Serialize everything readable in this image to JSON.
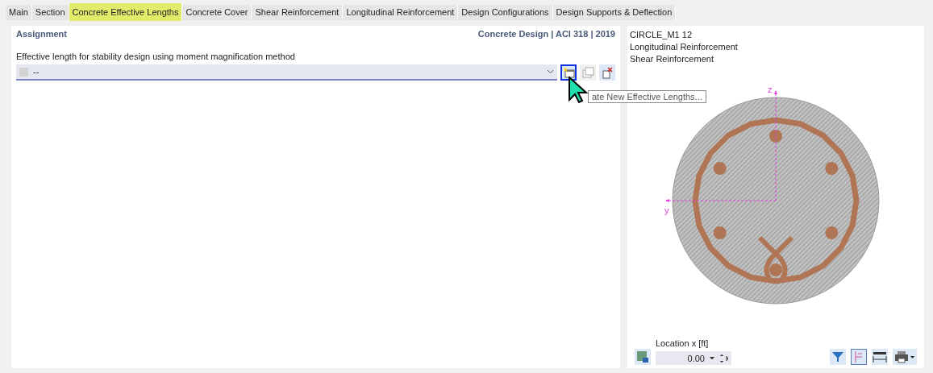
{
  "tabs": [
    {
      "label": "Main",
      "selected": false
    },
    {
      "label": "Section",
      "selected": false
    },
    {
      "label": "Concrete Effective Lengths",
      "selected": true
    },
    {
      "label": "Concrete Cover",
      "selected": false
    },
    {
      "label": "Shear Reinforcement",
      "selected": false
    },
    {
      "label": "Longitudinal Reinforcement",
      "selected": false
    },
    {
      "label": "Design Configurations",
      "selected": false
    },
    {
      "label": "Design Supports & Deflection",
      "selected": false
    }
  ],
  "assignment": {
    "title": "Assignment",
    "standard": "Concrete Design | ACI 318 | 2019",
    "field_label": "Effective length for stability design using moment magnification method",
    "select_value": "--",
    "tooltip": "ate New Effective Lengths..."
  },
  "preview": {
    "lines": [
      "CIRCLE_M1 12",
      "Longitudinal Reinforcement",
      "Shear Reinforcement"
    ],
    "axis_z": "z",
    "axis_y": "y",
    "location_label": "Location x [ft]",
    "location_value": "0.00"
  }
}
